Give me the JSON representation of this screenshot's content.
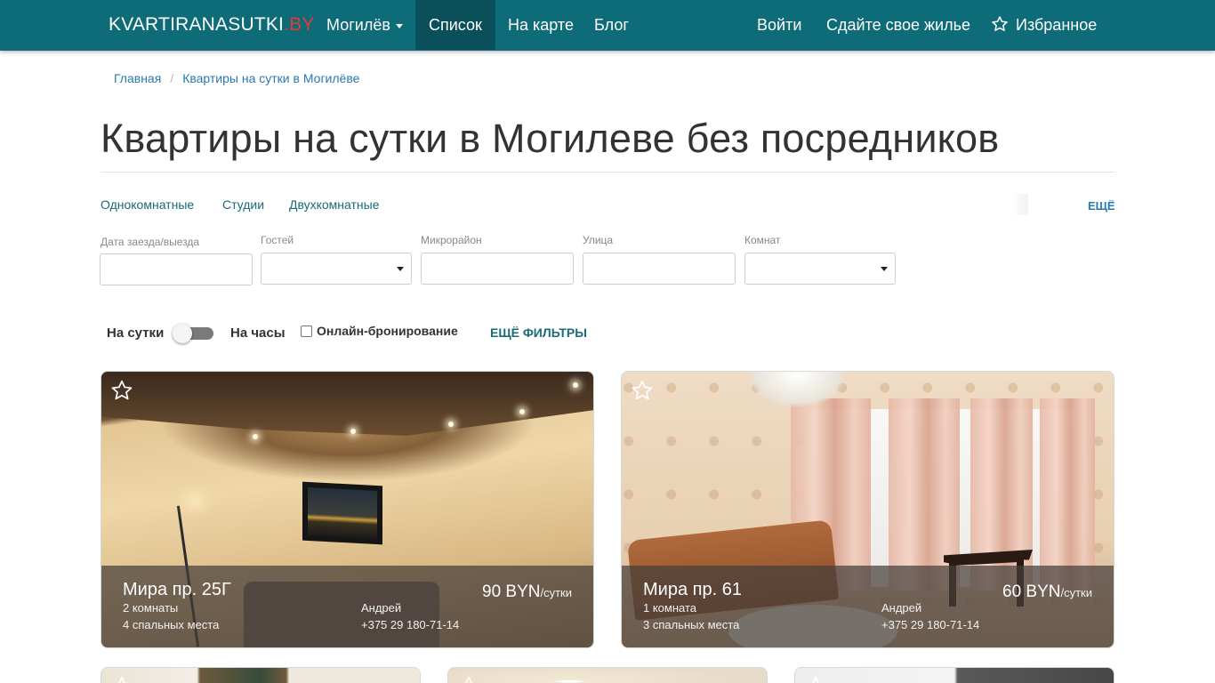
{
  "navbar": {
    "brand_name": "KVARTIRANASUTKI",
    "brand_tld": ".BY",
    "city": "Могилёв",
    "list": "Список",
    "map": "На карте",
    "blog": "Блог",
    "login": "Войти",
    "rent_out": "Сдайте свое жилье",
    "favorites": "Избранное"
  },
  "breadcrumb": {
    "home": "Главная",
    "current": "Квартиры на сутки в Могилёве"
  },
  "page_title": "Квартиры на сутки в Могилеве без посредников",
  "quick_links": [
    "Однокомнатные",
    "Студии",
    "Двухкомнатные"
  ],
  "quick_more": "ЕЩЁ",
  "filters": {
    "dates_label": "Дата заезда/выезда",
    "guests_label": "Гостей",
    "district_label": "Микрорайон",
    "street_label": "Улица",
    "rooms_label": "Комнат",
    "dates_value": "",
    "guests_value": "",
    "district_value": "",
    "street_value": "",
    "rooms_value": ""
  },
  "toggles": {
    "daily": "На сутки",
    "hourly": "На часы",
    "online_booking": "Онлайн-бронирование",
    "more_filters": "ЕЩЁ ФИЛЬТРЫ"
  },
  "listings": [
    {
      "street": "Мира пр. 25Г",
      "rooms": "2 комнаты",
      "beds": "4 спальных места",
      "owner": "Андрей",
      "phone": "+375 29 180-71-14",
      "price": "90 BYN",
      "price_unit": "/сутки"
    },
    {
      "street": "Мира пр. 61",
      "rooms": "1 комната",
      "beds": "3 спальных места",
      "owner": "Андрей",
      "phone": "+375 29 180-71-14",
      "price": "60 BYN",
      "price_unit": "/сутки"
    }
  ],
  "colors": {
    "navbar": "#0e6b78",
    "navbar_active": "#0a4f59",
    "brand_tld": "#e23b3b",
    "link": "#2a7ab0"
  },
  "icons": {
    "favorites": "star-outline-icon",
    "card_favorite": "star-outline-icon",
    "dropdown": "caret-down-icon"
  }
}
